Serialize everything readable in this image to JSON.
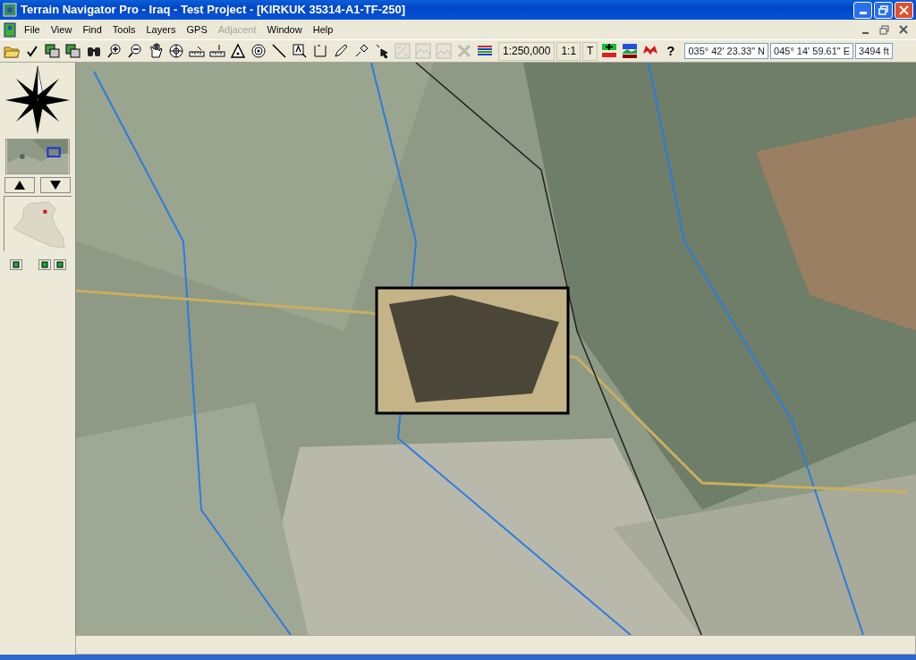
{
  "window": {
    "title": "Terrain Navigator Pro - Iraq - Test Project - [KIRKUK 35314-A1-TF-250]"
  },
  "menu": [
    {
      "label": "File",
      "disabled": false
    },
    {
      "label": "View",
      "disabled": false
    },
    {
      "label": "Find",
      "disabled": false
    },
    {
      "label": "Tools",
      "disabled": false
    },
    {
      "label": "Layers",
      "disabled": false
    },
    {
      "label": "GPS",
      "disabled": false
    },
    {
      "label": "Adjacent",
      "disabled": true
    },
    {
      "label": "Window",
      "disabled": false
    },
    {
      "label": "Help",
      "disabled": false
    }
  ],
  "toolbar": {
    "tools": [
      {
        "disabled": false
      },
      {
        "disabled": false
      },
      {
        "disabled": false
      },
      {
        "disabled": false
      },
      {
        "disabled": false
      },
      {
        "disabled": false
      },
      {
        "disabled": false
      },
      {
        "disabled": false
      },
      {
        "disabled": false
      },
      {
        "disabled": false
      },
      {
        "disabled": false
      },
      {
        "disabled": false
      },
      {
        "disabled": false
      },
      {
        "disabled": false
      },
      {
        "disabled": false
      },
      {
        "disabled": false
      },
      {
        "disabled": false
      },
      {
        "disabled": false
      },
      {
        "disabled": false
      },
      {
        "disabled": true
      },
      {
        "disabled": true
      },
      {
        "disabled": true
      },
      {
        "disabled": true
      },
      {
        "disabled": false
      }
    ],
    "scale": "1:250,000",
    "one_to_one": "1:1",
    "text_tool": "T",
    "help": "?",
    "latitude": "035° 42' 23.33\" N",
    "longitude": "045° 14' 59.61\" E",
    "elevation": "3494 ft"
  }
}
